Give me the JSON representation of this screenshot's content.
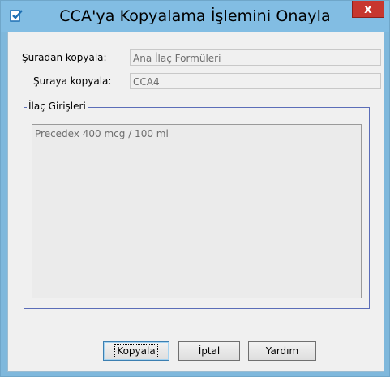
{
  "window": {
    "title": "CCA'ya Kopyalama İşlemini Onayla",
    "close_label": "x",
    "app_icon": "checkmark-document-icon",
    "accent_color": "#82bde3"
  },
  "form": {
    "from_label": "Şuradan kopyala:",
    "from_value": "Ana İlaç Formüleri",
    "to_label": "Şuraya kopyala:",
    "to_value": "CCA4"
  },
  "drug_entries": {
    "legend": "İlaç Girişleri",
    "items": [
      "Precedex 400 mcg / 100 ml"
    ]
  },
  "buttons": {
    "copy": "Kopyala",
    "cancel": "İptal",
    "help": "Yardım"
  }
}
